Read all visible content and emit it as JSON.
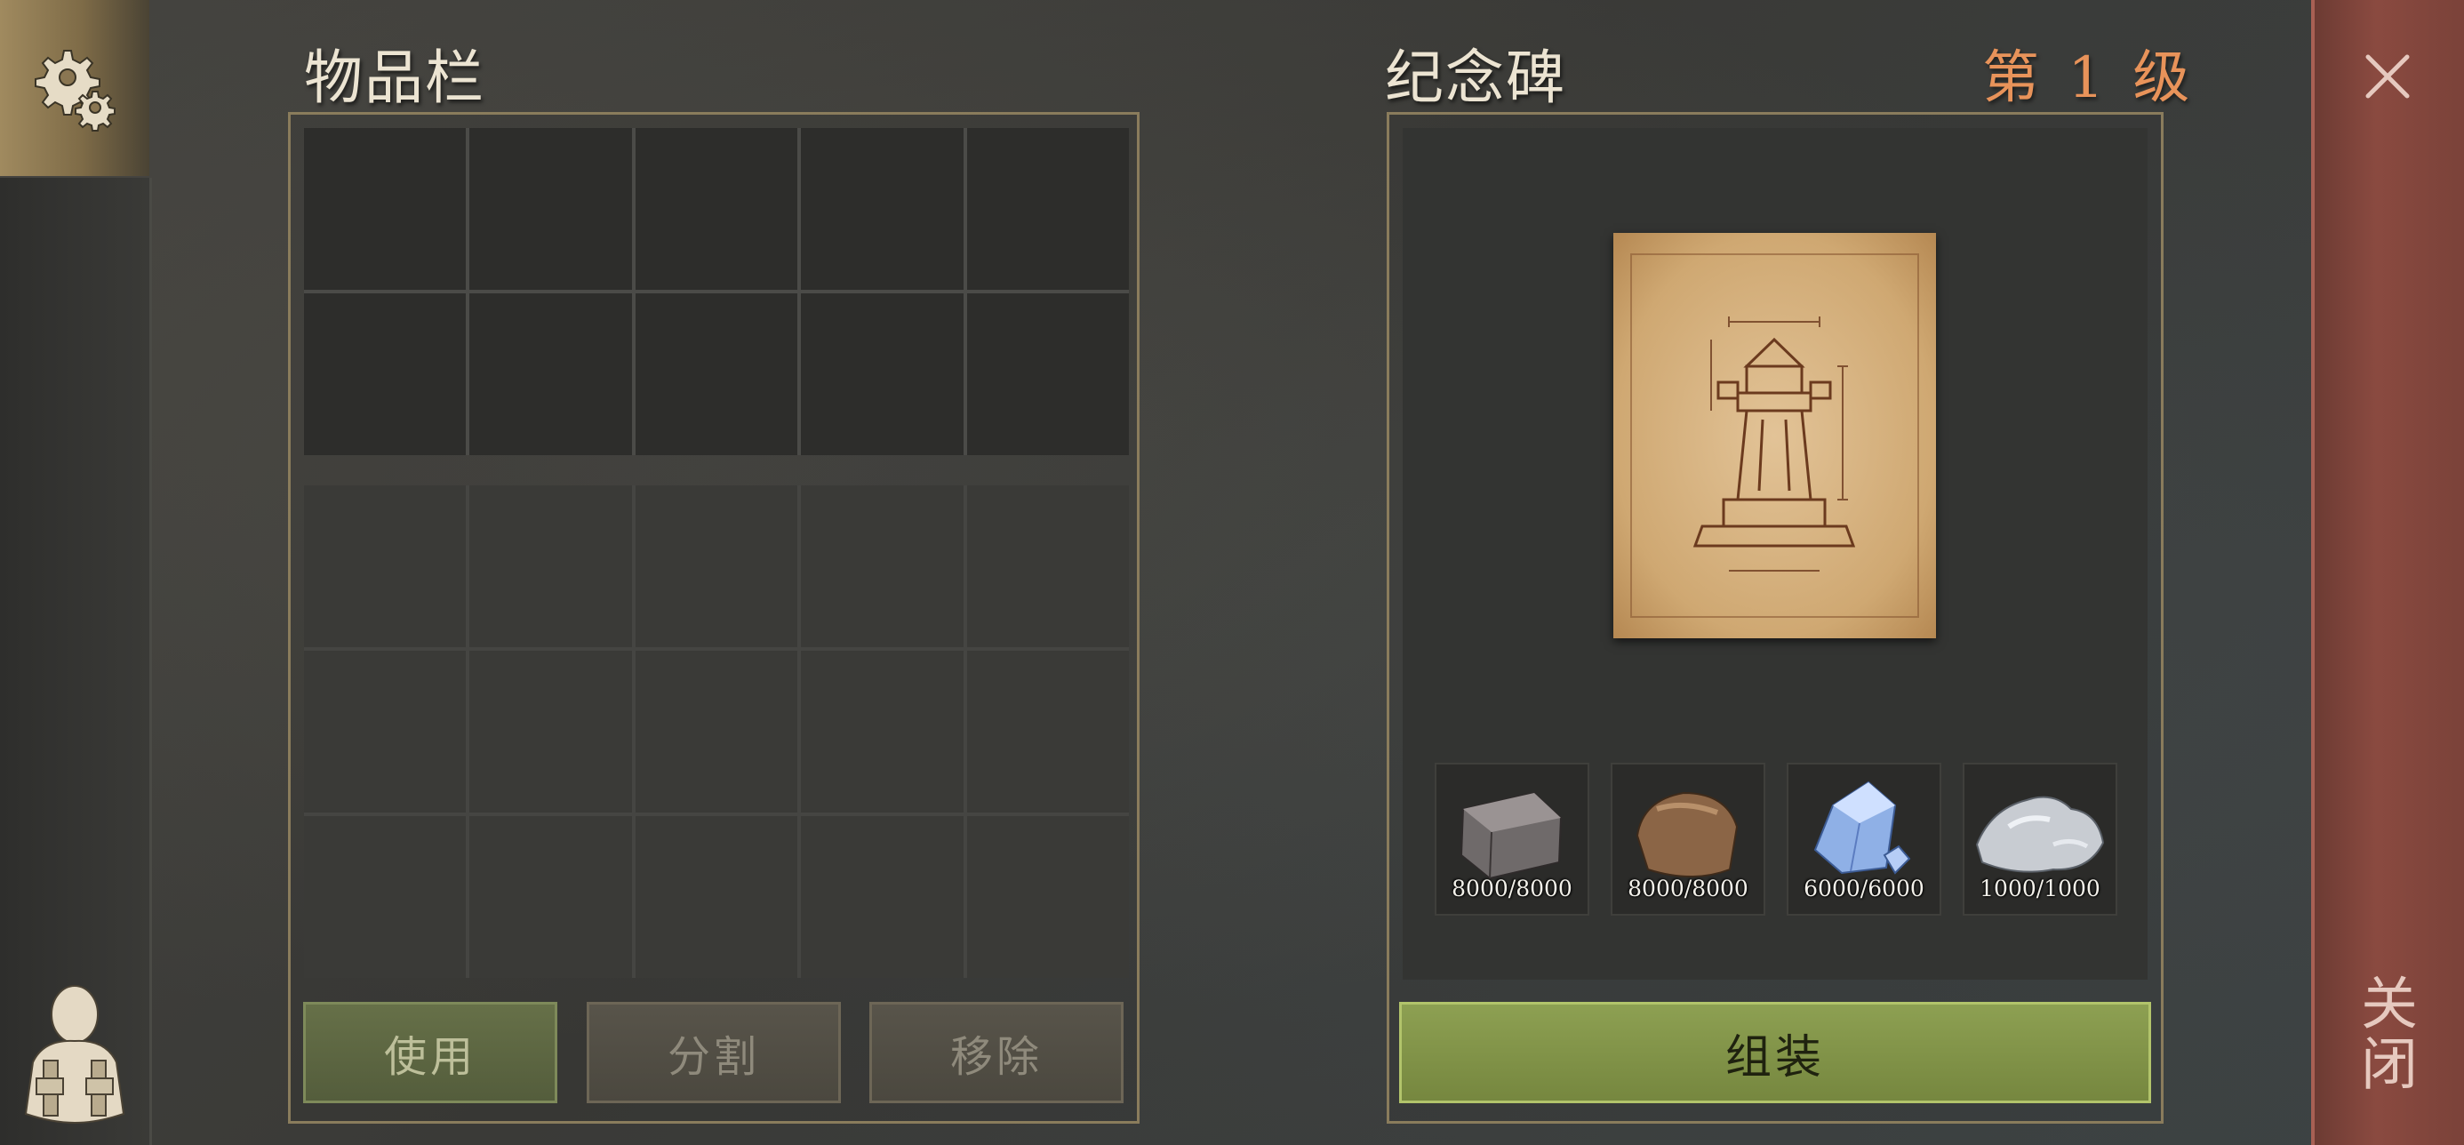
{
  "inventory": {
    "title": "物品栏",
    "buttons": {
      "use": "使用",
      "split": "分割",
      "remove": "移除"
    }
  },
  "build": {
    "title": "纪念碑",
    "level": "第 1 级",
    "assemble": "组装",
    "resources": [
      {
        "icon": "stone-block-icon",
        "count": "8000/8000"
      },
      {
        "icon": "rock-icon",
        "count": "8000/8000"
      },
      {
        "icon": "crystal-icon",
        "count": "6000/6000"
      },
      {
        "icon": "ore-icon",
        "count": "1000/1000"
      }
    ]
  },
  "close": {
    "label": "关闭",
    "icon": "close-icon"
  },
  "sidebar": {
    "settings_icon": "gear-icon",
    "character_icon": "backpack-character-icon"
  },
  "colors": {
    "level": "#e8935a",
    "assemble_button": "#8da052",
    "close_rail": "#7a4239"
  }
}
